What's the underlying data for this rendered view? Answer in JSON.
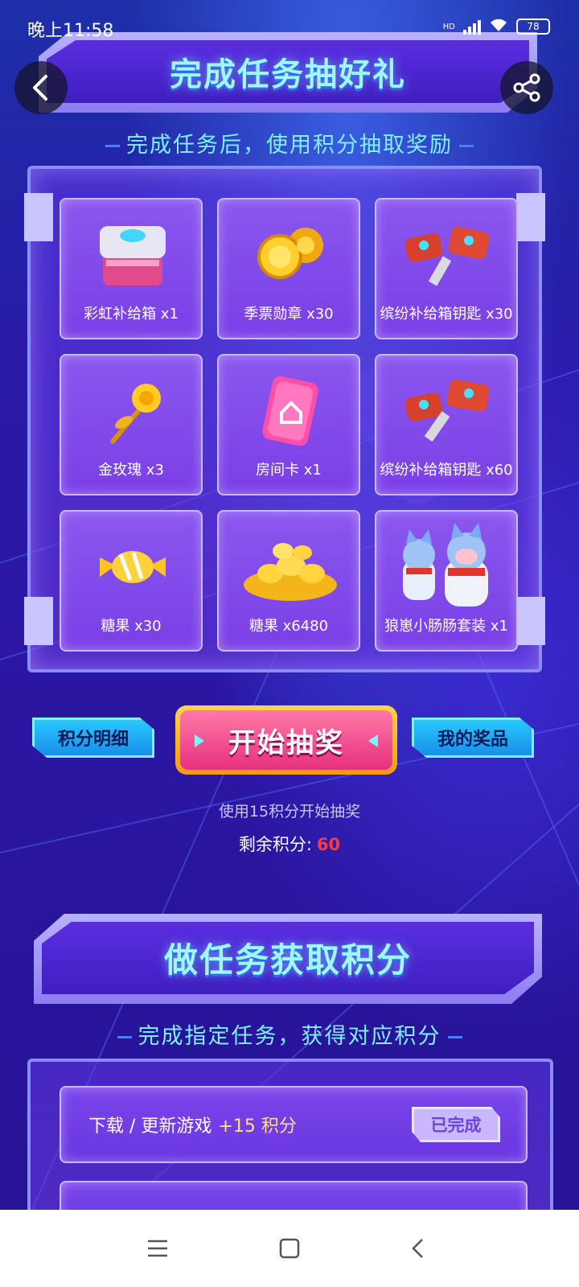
{
  "status_bar": {
    "time": "晚上11:58",
    "network": "HD",
    "battery": "78"
  },
  "header": {
    "title": "完成任务抽好礼",
    "subtitle": "完成任务后，使用积分抽取奖励",
    "back_icon": "chevron-left-icon",
    "share_icon": "share-icon"
  },
  "prizes": [
    {
      "label": "彩虹补给箱 x1",
      "icon": "supply-box-icon"
    },
    {
      "label": "季票勋章 x30",
      "icon": "gold-medal-icon"
    },
    {
      "label": "缤纷补给箱钥匙 x30",
      "icon": "key-icon"
    },
    {
      "label": "金玫瑰 x3",
      "icon": "gold-rose-icon"
    },
    {
      "label": "房间卡 x1",
      "icon": "room-card-icon"
    },
    {
      "label": "缤纷补给箱钥匙 x60",
      "icon": "key-icon"
    },
    {
      "label": "糖果 x30",
      "icon": "candy-icon"
    },
    {
      "label": "糖果 x6480",
      "icon": "candy-pile-icon"
    },
    {
      "label": "狼崽小肠肠套装 x1",
      "icon": "wolf-costume-icon"
    }
  ],
  "actions": {
    "points_detail": "积分明细",
    "draw": "开始抽奖",
    "my_prizes": "我的奖品",
    "draw_note": "使用15积分开始抽奖",
    "remaining_label": "剩余积分:",
    "remaining_value": "60"
  },
  "tasks_section": {
    "title": "做任务获取积分",
    "subtitle": "完成指定任务，获得对应积分",
    "tasks": [
      {
        "name": "下载 / 更新游戏",
        "points": "+15 积分",
        "state": "已完成"
      }
    ]
  },
  "colors": {
    "accent_cyan": "#7ff0ff",
    "points_red": "#ff3b3b",
    "draw_pink": "#e6307d",
    "draw_gold": "#ffd34a"
  }
}
